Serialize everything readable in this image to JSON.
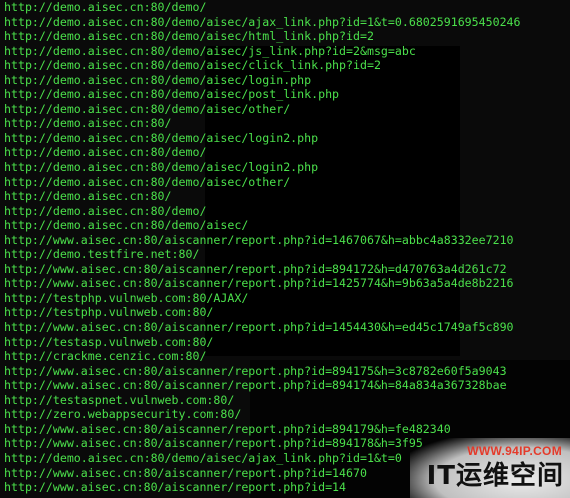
{
  "terminal": {
    "lines": [
      "http://demo.aisec.cn:80/demo/",
      "http://demo.aisec.cn:80/demo/aisec/ajax_link.php?id=1&t=0.6802591695450246",
      "http://demo.aisec.cn:80/demo/aisec/html_link.php?id=2",
      "http://demo.aisec.cn:80/demo/aisec/js_link.php?id=2&msg=abc",
      "http://demo.aisec.cn:80/demo/aisec/click_link.php?id=2",
      "http://demo.aisec.cn:80/demo/aisec/login.php",
      "http://demo.aisec.cn:80/demo/aisec/post_link.php",
      "http://demo.aisec.cn:80/demo/aisec/other/",
      "http://demo.aisec.cn:80/",
      "http://demo.aisec.cn:80/demo/aisec/login2.php",
      "http://demo.aisec.cn:80/demo/",
      "http://demo.aisec.cn:80/demo/aisec/login2.php",
      "http://demo.aisec.cn:80/demo/aisec/other/",
      "http://demo.aisec.cn:80/",
      "http://demo.aisec.cn:80/demo/",
      "http://demo.aisec.cn:80/demo/aisec/",
      "http://www.aisec.cn:80/aiscanner/report.php?id=1467067&h=abbc4a8332ee7210",
      "http://demo.testfire.net:80/",
      "http://www.aisec.cn:80/aiscanner/report.php?id=894172&h=d470763a4d261c72",
      "http://www.aisec.cn:80/aiscanner/report.php?id=1425774&h=9b63a5a4de8b2216",
      "http://testphp.vulnweb.com:80/AJAX/",
      "http://testphp.vulnweb.com:80/",
      "http://www.aisec.cn:80/aiscanner/report.php?id=1454430&h=ed45c1749af5c890",
      "http://testasp.vulnweb.com:80/",
      "http://crackme.cenzic.com:80/",
      "http://www.aisec.cn:80/aiscanner/report.php?id=894175&h=3c8782e60f5a9043",
      "http://www.aisec.cn:80/aiscanner/report.php?id=894174&h=84a834a367328bae",
      "http://testaspnet.vulnweb.com:80/",
      "http://zero.webappsecurity.com:80/",
      "http://www.aisec.cn:80/aiscanner/report.php?id=894179&h=fe482340",
      "http://www.aisec.cn:80/aiscanner/report.php?id=894178&h=3f95",
      "http://demo.aisec.cn:80/demo/aisec/ajax_link.php?id=1&t=0",
      "http://www.aisec.cn:80/aiscanner/report.php?id=14670",
      "http://www.aisec.cn:80/aiscanner/report.php?id=14"
    ],
    "text_color": "#4be04b",
    "background_color": "#0a0a0a"
  },
  "watermark": {
    "domain": "WWW.94IP.COM",
    "brand": "IT运维空间",
    "domain_color": "#e53a2a",
    "brand_color": "#111111"
  }
}
